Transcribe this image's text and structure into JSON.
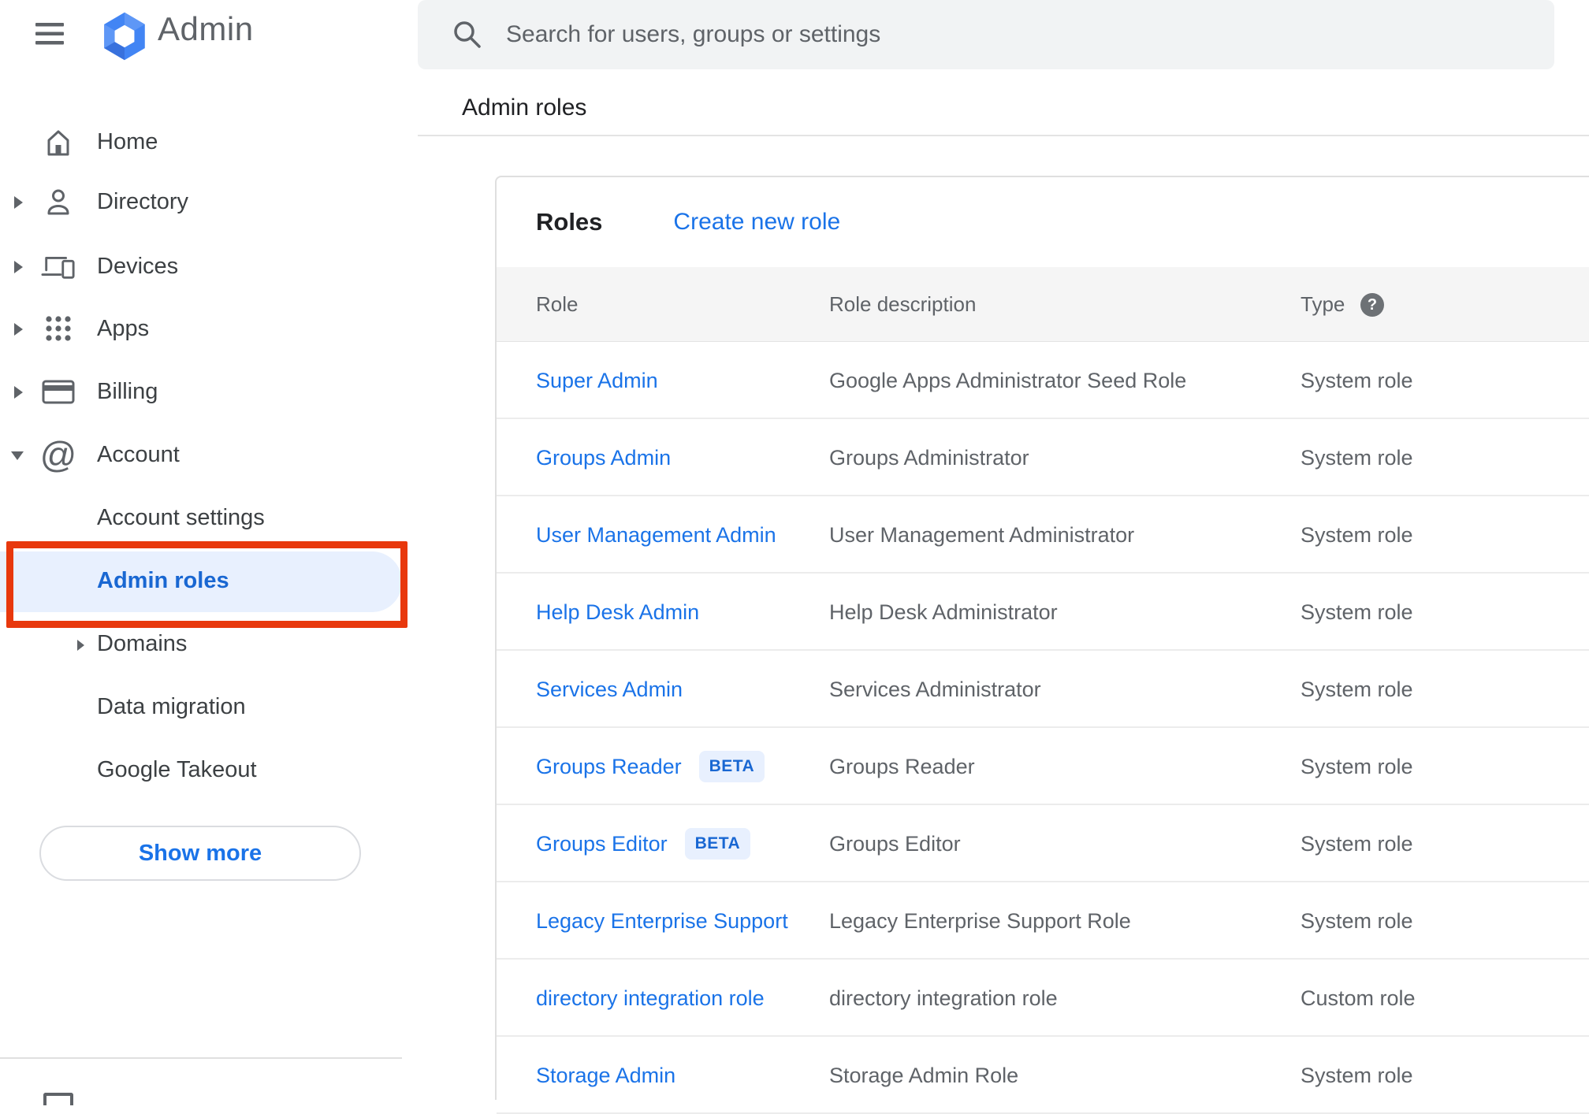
{
  "app": {
    "name": "Admin"
  },
  "topbar": {
    "search_placeholder": "Search for users, groups or settings"
  },
  "breadcrumb": "Admin roles",
  "sidebar": {
    "items": [
      {
        "label": "Home"
      },
      {
        "label": "Directory"
      },
      {
        "label": "Devices"
      },
      {
        "label": "Apps"
      },
      {
        "label": "Billing"
      },
      {
        "label": "Account"
      }
    ],
    "account_children": [
      {
        "label": "Account settings"
      },
      {
        "label": "Admin roles",
        "selected": true
      },
      {
        "label": "Domains"
      },
      {
        "label": "Data migration"
      },
      {
        "label": "Google Takeout"
      }
    ],
    "show_more_label": "Show more"
  },
  "main": {
    "title": "Roles",
    "create_link": "Create new role",
    "table": {
      "headers": [
        "Role",
        "Role description",
        "Type"
      ],
      "rows": [
        {
          "role": "Super Admin",
          "description": "Google Apps Administrator Seed Role",
          "type": "System role"
        },
        {
          "role": "Groups Admin",
          "description": "Groups Administrator",
          "type": "System role"
        },
        {
          "role": "User Management Admin",
          "description": "User Management Administrator",
          "type": "System role"
        },
        {
          "role": "Help Desk Admin",
          "description": "Help Desk Administrator",
          "type": "System role"
        },
        {
          "role": "Services Admin",
          "description": "Services Administrator",
          "type": "System role"
        },
        {
          "role": "Groups Reader",
          "beta": "BETA",
          "description": "Groups Reader",
          "type": "System role"
        },
        {
          "role": "Groups Editor",
          "beta": "BETA",
          "description": "Groups Editor",
          "type": "System role"
        },
        {
          "role": "Legacy Enterprise Support",
          "description": "Legacy Enterprise Support Role",
          "type": "System role"
        },
        {
          "role": "directory integration role",
          "description": "directory integration role",
          "type": "Custom role"
        },
        {
          "role": "Storage Admin",
          "description": "Storage Admin Role",
          "type": "System role"
        }
      ]
    }
  },
  "icons": {
    "menu": "hamburger",
    "logo": "blue-hexagon",
    "search": "magnifier",
    "home": "house",
    "directory": "person",
    "devices": "laptop-phone",
    "apps": "dots-grid",
    "billing": "credit-card",
    "account": "at-sign",
    "help": "question-mark-circle",
    "expand_collapsed": "right-triangle",
    "expand_expanded": "down-triangle"
  },
  "colors": {
    "accent_blue": "#1a73e8",
    "selected_blue": "#1967d2",
    "selected_bg": "#e8f0fe",
    "annotation_red": "#e8380d",
    "text_dark": "#202124",
    "text_gray": "#5f6368",
    "searchbar_bg": "#f1f3f4",
    "table_header_bg": "#f5f5f5",
    "logo_blue": "#4285f4"
  }
}
